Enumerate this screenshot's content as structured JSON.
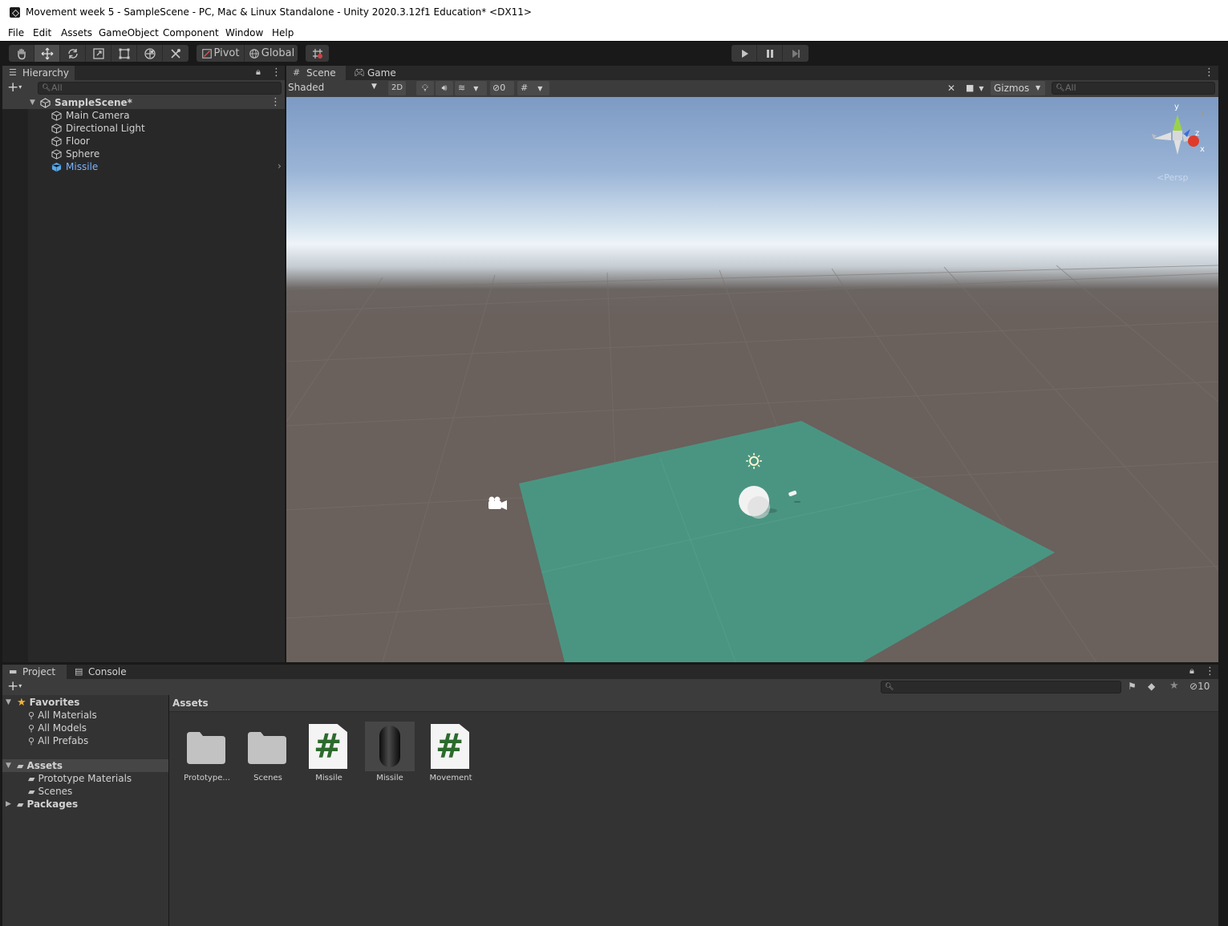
{
  "window": {
    "title": "Movement week 5 - SampleScene - PC, Mac & Linux Standalone - Unity 2020.3.12f1 Education* <DX11>"
  },
  "menu": [
    "File",
    "Edit",
    "Assets",
    "GameObject",
    "Component",
    "Window",
    "Help"
  ],
  "toolbar": {
    "tools": [
      "hand-tool",
      "move-tool",
      "rotate-tool",
      "scale-tool",
      "rect-tool",
      "transform-tool",
      "custom-tool"
    ],
    "active_tool": "move-tool",
    "pivot_label": "Pivot",
    "global_label": "Global",
    "play_controls": [
      "play",
      "pause",
      "step"
    ]
  },
  "hierarchy": {
    "tab_label": "Hierarchy",
    "search_placeholder": "All",
    "scene_name": "SampleScene*",
    "items": [
      {
        "label": "Main Camera",
        "selected": false
      },
      {
        "label": "Directional Light",
        "selected": false
      },
      {
        "label": "Floor",
        "selected": false
      },
      {
        "label": "Sphere",
        "selected": false
      },
      {
        "label": "Missile",
        "selected": true
      }
    ]
  },
  "scene_view": {
    "tabs": [
      {
        "label": "Scene",
        "icon": "grid-icon",
        "active": true
      },
      {
        "label": "Game",
        "icon": "gamepad-icon",
        "active": false
      }
    ],
    "draw_mode": "Shaded",
    "mode_2d_label": "2D",
    "hidden_count": "0",
    "gizmos_label": "Gizmos",
    "search_placeholder": "All",
    "gizmo_axes": {
      "y": "y",
      "z": "z",
      "x": "x"
    },
    "persp_label": "<Persp",
    "floor_color": "#4a9582",
    "sky_top": "#7d9ac4",
    "ground_color": "#6a605c"
  },
  "project": {
    "tabs": [
      {
        "label": "Project",
        "icon": "folder-icon",
        "active": true
      },
      {
        "label": "Console",
        "icon": "console-icon",
        "active": false
      }
    ],
    "hidden_packages_count": "10",
    "favorites_label": "Favorites",
    "favorites": [
      "All Materials",
      "All Models",
      "All Prefabs"
    ],
    "assets_label": "Assets",
    "asset_folders": [
      "Prototype Materials",
      "Scenes"
    ],
    "packages_label": "Packages",
    "breadcrumb": "Assets",
    "grid_items": [
      {
        "label": "Prototype...",
        "kind": "folder"
      },
      {
        "label": "Scenes",
        "kind": "folder"
      },
      {
        "label": "Missile",
        "kind": "script"
      },
      {
        "label": "Missile",
        "kind": "prefab"
      },
      {
        "label": "Movement",
        "kind": "script"
      }
    ]
  }
}
